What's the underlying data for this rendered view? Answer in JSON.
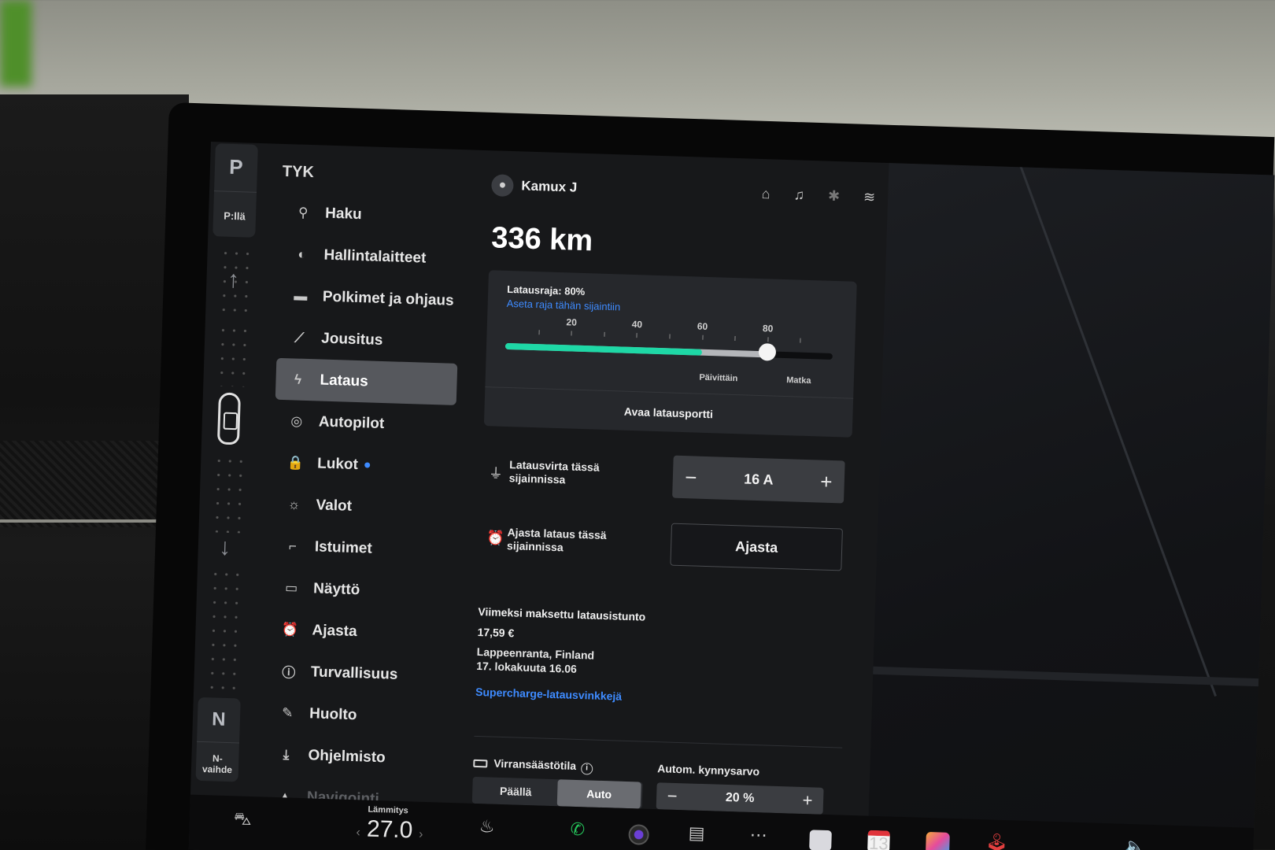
{
  "gear": {
    "park_letter": "P",
    "park_label": "P:llä",
    "neutral_letter": "N",
    "neutral_label_1": "N-",
    "neutral_label_2": "vaihde"
  },
  "sidebar": {
    "title": "TYK",
    "items": [
      {
        "label": "Haku",
        "icon": "search-icon",
        "glyph": "⚲"
      },
      {
        "label": "Hallintalaitteet",
        "icon": "toggle-icon",
        "glyph": "◐"
      },
      {
        "label": "Polkimet ja ohjaus",
        "icon": "car-icon",
        "glyph": "▬"
      },
      {
        "label": "Jousitus",
        "icon": "suspension-icon",
        "glyph": "⟋"
      },
      {
        "label": "Lataus",
        "icon": "lightning-icon",
        "glyph": "ϟ"
      },
      {
        "label": "Autopilot",
        "icon": "steering-wheel-icon",
        "glyph": "◎"
      },
      {
        "label": "Lukot",
        "icon": "lock-icon",
        "glyph": "🔒"
      },
      {
        "label": "Valot",
        "icon": "light-icon",
        "glyph": "☼"
      },
      {
        "label": "Istuimet",
        "icon": "seat-icon",
        "glyph": "⌐"
      },
      {
        "label": "Näyttö",
        "icon": "display-icon",
        "glyph": "▭"
      },
      {
        "label": "Ajasta",
        "icon": "alarm-icon",
        "glyph": "⏰"
      },
      {
        "label": "Turvallisuus",
        "icon": "safety-icon",
        "glyph": "ⓘ"
      },
      {
        "label": "Huolto",
        "icon": "wrench-icon",
        "glyph": "✎"
      },
      {
        "label": "Ohjelmisto",
        "icon": "download-icon",
        "glyph": "⤓"
      },
      {
        "label": "Navigointi",
        "icon": "navigation-icon",
        "glyph": "▲"
      }
    ],
    "active_index": 4
  },
  "header": {
    "user_name": "Kamux J",
    "icons": [
      "home-icon",
      "bell-icon",
      "bluetooth-icon",
      "wifi-icon"
    ]
  },
  "range": "336 km",
  "charge_card": {
    "limit_title": "Latausraja: 80%",
    "limit_link": "Aseta raja tähän sijaintiin",
    "tick_labels": [
      "20",
      "40",
      "60",
      "80"
    ],
    "current_fraction": 0.6,
    "limit_fraction": 0.8,
    "seg_daily": "Päivittäin",
    "seg_trip": "Matka",
    "open_port": "Avaa latausportti"
  },
  "current_row": {
    "label": "Latausvirta tässä sijainnissa",
    "value": "16 A",
    "minus": "−",
    "plus": "+"
  },
  "schedule_row": {
    "label": "Ajasta lataus tässä sijainnissa",
    "button": "Ajasta"
  },
  "last_session": {
    "title": "Viimeksi maksettu latausistunto",
    "price": "17,59 €",
    "location": "Lappeenranta, Finland",
    "date": "17. lokakuuta 16.06",
    "link": "Supercharge-latausvinkkejä"
  },
  "energy_saving": {
    "label": "Virransäästötila",
    "option_on": "Päällä",
    "option_auto": "Auto",
    "selected": "Auto",
    "threshold_label": "Autom. kynnysarvo",
    "threshold_value": "20 %",
    "minus": "−",
    "plus": "+"
  },
  "dock": {
    "temp_label": "Lämmitys",
    "temp_value": "27.0",
    "apps": [
      "car-icon",
      "seat-heater-icon",
      "phone-icon",
      "camera-icon",
      "media-icon",
      "more-icon",
      "notes-icon",
      "calendar-icon",
      "games-icon",
      "joystick-icon",
      "volume-icon"
    ],
    "calendar_day": "13"
  },
  "colors": {
    "accent_blue": "#3e8bff",
    "charge_green": "#1ed8a6",
    "active_item": "#56585d"
  }
}
